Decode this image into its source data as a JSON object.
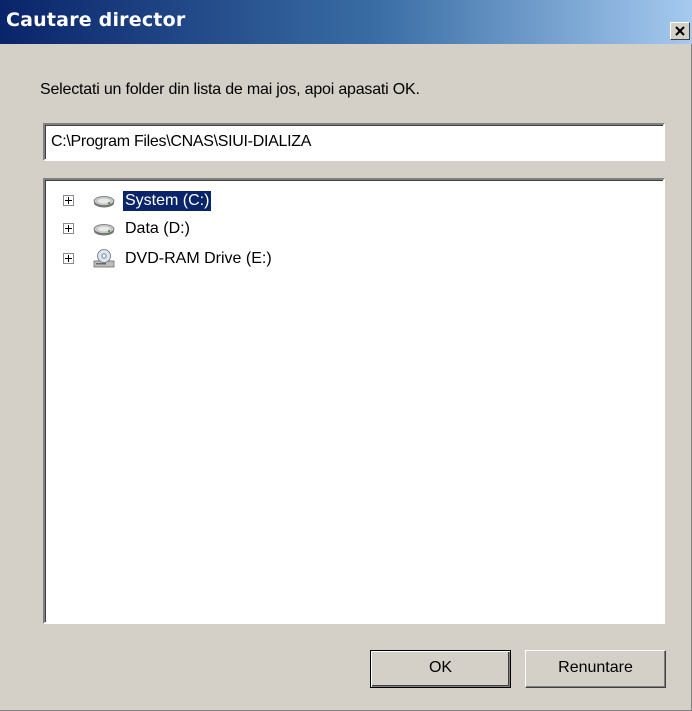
{
  "window": {
    "title": "Cautare director"
  },
  "instruction": "Selectati un folder din lista de mai jos, apoi apasati OK.",
  "path_field": {
    "value": "C:\\Program Files\\CNAS\\SIUI-DIALIZA"
  },
  "tree": {
    "items": [
      {
        "label": "System (C:)",
        "icon": "hard-drive-icon",
        "selected": true
      },
      {
        "label": "Data (D:)",
        "icon": "hard-drive-icon",
        "selected": false
      },
      {
        "label": "DVD-RAM Drive (E:)",
        "icon": "dvd-drive-icon",
        "selected": false
      }
    ]
  },
  "buttons": {
    "ok_label": "OK",
    "cancel_label": "Renuntare"
  },
  "colors": {
    "title_start": "#0a246a",
    "title_end": "#a6caf0",
    "face": "#d4d0c8",
    "selection": "#0a246a"
  }
}
